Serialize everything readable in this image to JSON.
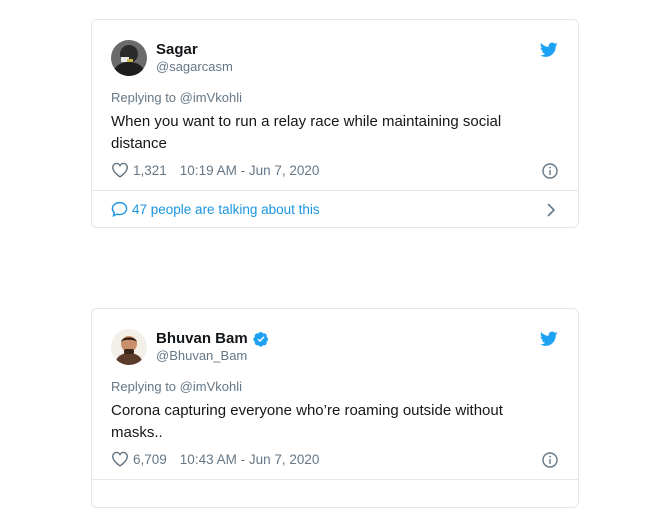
{
  "tweets": [
    {
      "name": "Sagar",
      "handle": "@sagarcasm",
      "replying_label": "Replying to",
      "replying_to": "@imVkohli",
      "text": "When you want to run a relay race while maintaining social distance",
      "likes": "1,321",
      "timestamp": "10:19 AM - Jun 7, 2020",
      "talking": "47 people are talking about this",
      "verified": false
    },
    {
      "name": "Bhuvan Bam",
      "handle": "@Bhuvan_Bam",
      "replying_label": "Replying to",
      "replying_to": "@imVkohli",
      "text": "Corona capturing everyone who’re roaming outside without masks..",
      "likes": "6,709",
      "timestamp": "10:43 AM - Jun 7, 2020",
      "verified": true
    }
  ],
  "colors": {
    "twitter_blue": "#1da1f2",
    "link_blue": "#1b95e0",
    "muted": "#657786",
    "text": "#14171a",
    "border": "#e1e8ed"
  },
  "icons": [
    "avatar",
    "twitter-bird-icon",
    "heart-icon",
    "info-icon",
    "comment-icon",
    "chevron-right-icon",
    "verified-badge-icon"
  ]
}
